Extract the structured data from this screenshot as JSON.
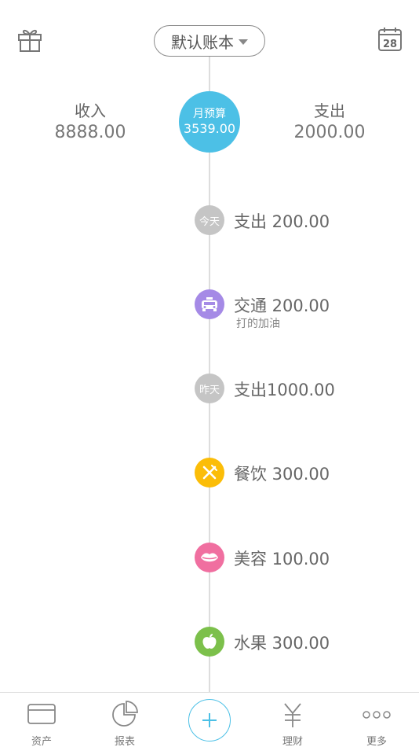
{
  "header": {
    "book_label": "默认账本",
    "calendar_day": "28"
  },
  "summary": {
    "income_label": "收入",
    "income_value": "8888.00",
    "budget_label": "月预算",
    "budget_value": "3539.00",
    "expense_label": "支出",
    "expense_value": "2000.00"
  },
  "entries": [
    {
      "icon": "today-badge",
      "badge": "今天",
      "text": "支出 200.00"
    },
    {
      "icon": "taxi-icon",
      "text": "交通 200.00",
      "note": "打的加油"
    },
    {
      "icon": "yesterday-badge",
      "badge": "昨天",
      "text": "支出1000.00"
    },
    {
      "icon": "fork-knife-icon",
      "text": "餐饮 300.00"
    },
    {
      "icon": "lips-icon",
      "text": "美容 100.00"
    },
    {
      "icon": "apple-icon",
      "text": "水果 300.00"
    }
  ],
  "tabs": [
    {
      "icon": "card-icon",
      "label": "资产"
    },
    {
      "icon": "pie-chart-icon",
      "label": "报表"
    },
    {
      "icon": "plus-icon",
      "label": ""
    },
    {
      "icon": "yen-icon",
      "label": "理财"
    },
    {
      "icon": "more-dots-icon",
      "label": "更多"
    }
  ],
  "colors": {
    "accent": "#4cc0e6",
    "transport": "#a58ae6",
    "food": "#fbbd08",
    "beauty": "#f06fa0",
    "fruit": "#7cc04b",
    "date_badge": "#c5c5c5"
  }
}
